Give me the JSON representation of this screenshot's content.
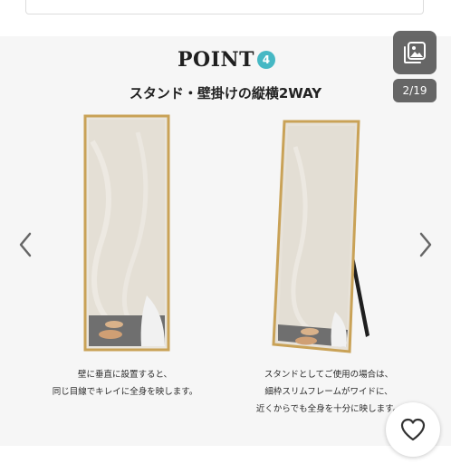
{
  "point": {
    "label": "POINT",
    "number": "4",
    "badge_color": "#46b8c4"
  },
  "subtitle": "スタンド・壁掛けの縦横2WAY",
  "gallery": {
    "counter": "2/19",
    "icon": "gallery-icon"
  },
  "nav": {
    "prev_icon": "chevron-left-icon",
    "next_icon": "chevron-right-icon"
  },
  "captions": {
    "left": [
      "壁に垂直に設置すると、",
      "同じ目線でキレイに全身を映します。"
    ],
    "right": [
      "スタンドとしてご使用の場合は、",
      "細枠スリムフレームがワイドに、",
      "近くからでも全身を十分に映します。"
    ]
  },
  "favorite": {
    "icon": "heart-icon"
  },
  "colors": {
    "frame": "#c9a257",
    "mirror": "#e6e1d8",
    "accent": "#46b8c4"
  }
}
